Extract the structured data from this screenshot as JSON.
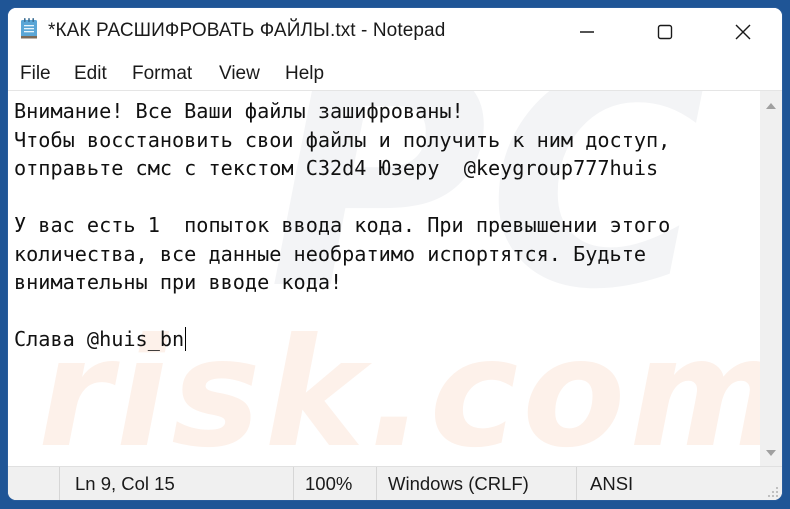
{
  "window": {
    "title": "*КАК РАСШИФРОВАТЬ ФАЙЛЫ.txt - Notepad",
    "app_icon": "notepad-icon",
    "controls": {
      "minimize": "minimize-icon",
      "maximize": "maximize-icon",
      "close": "close-icon"
    }
  },
  "menu": {
    "items": [
      {
        "label": "File"
      },
      {
        "label": "Edit"
      },
      {
        "label": "Format"
      },
      {
        "label": "View"
      },
      {
        "label": "Help"
      }
    ]
  },
  "editor": {
    "lines": [
      "Внимание! Все Ваши файлы зашифрованы!",
      "Чтобы восстановить свои файлы и получить к ним доступ,",
      "отправьте смс с текстом C32d4 Юзеру  @keygroup777huis",
      "",
      "У вас есть 1  попыток ввода кода. При превышении этого",
      "количества, все данные необратимо испортятся. Будьте",
      "внимательны при вводе кода!",
      "",
      "Слава @huis_bn"
    ],
    "watermark": "pcrisk.com"
  },
  "statusbar": {
    "position": "Ln 9, Col 15",
    "zoom": "100%",
    "line_ending": "Windows (CRLF)",
    "encoding": "ANSI"
  },
  "colors": {
    "desktop_background": "#1f5596",
    "window_background": "#ffffff",
    "statusbar_background": "#f0f0f0",
    "text": "#111111",
    "watermark": "#fdf1ea"
  }
}
